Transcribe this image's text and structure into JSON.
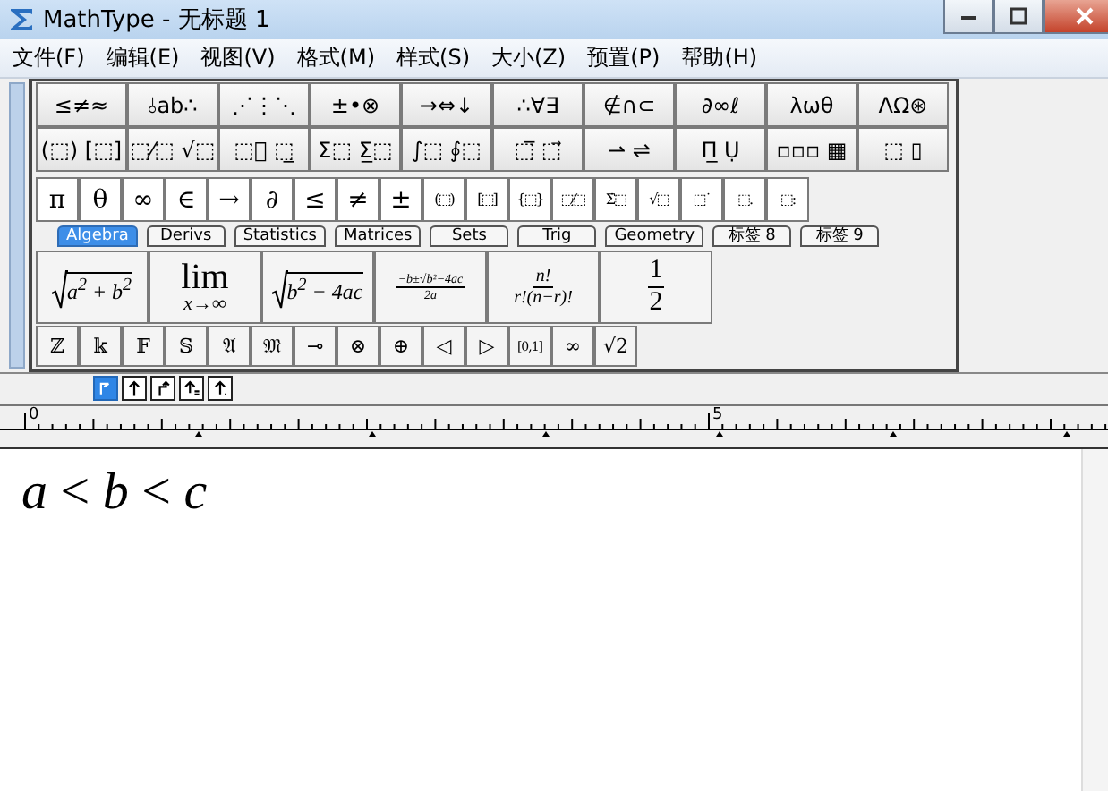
{
  "window": {
    "title": "MathType - 无标题 1"
  },
  "menu": [
    "文件(F)",
    "编辑(E)",
    "视图(V)",
    "格式(M)",
    "样式(S)",
    "大小(Z)",
    "预置(P)",
    "帮助(H)"
  ],
  "palette_row_1": [
    "≤≠≈",
    "⫰ab∴",
    "⋰⋮⋱",
    "±•⊗",
    "→⇔↓",
    "∴∀∃",
    "∉∩⊂",
    "∂∞ℓ",
    "λωθ",
    "ΛΩ⊛"
  ],
  "palette_row_2": [
    "(⬚) [⬚]",
    "⬚⁄⬚ √⬚",
    "⬚⃞ ⬚̲",
    "Σ⬚ Σ̲⬚",
    "∫⬚ ∮⬚",
    "⬚̅ ⬚⃗",
    "⇀ ⇌",
    "Π̲ Ụ",
    "▫▫▫ ▦",
    "⬚ ▯"
  ],
  "symbol_row": [
    "π",
    "θ",
    "∞",
    "∈",
    "→",
    "∂",
    "≤",
    "≠",
    "±",
    "(⬚)",
    "[⬚]",
    "{⬚}",
    "⬚⁄⬚",
    "Σ̇⬚",
    "√⬚",
    "⬚˙",
    "⬚.",
    "⬚:"
  ],
  "tabs": [
    {
      "label": "Algebra",
      "selected": true
    },
    {
      "label": "Derivs",
      "selected": false
    },
    {
      "label": "Statistics",
      "selected": false
    },
    {
      "label": "Matrices",
      "selected": false
    },
    {
      "label": "Sets",
      "selected": false
    },
    {
      "label": "Trig",
      "selected": false
    },
    {
      "label": "Geometry",
      "selected": false
    },
    {
      "label": "标签 8",
      "selected": false
    },
    {
      "label": "标签 9",
      "selected": false
    }
  ],
  "templates": [
    {
      "kind": "sqrt",
      "body": "*a*$^{2}$ + *b*$^{2}$"
    },
    {
      "kind": "limit",
      "top": "lim",
      "bottom": "x→∞"
    },
    {
      "kind": "sqrt",
      "body": "b$^{2}$ − 4ac"
    },
    {
      "kind": "fraction",
      "numerator": "−b±√b²−4ac",
      "denominator": "2a"
    },
    {
      "kind": "fraction",
      "numerator": "n!",
      "denominator": "r!(n−r)!"
    },
    {
      "kind": "fraction",
      "numerator": "1",
      "denominator": "2"
    }
  ],
  "bottom_row": [
    "ℤ",
    "𝕜",
    "𝔽",
    "𝕊",
    "𝔄",
    "𝔐",
    "⊸",
    "⊗",
    "⊕",
    "◁",
    "▷",
    "[0,1]",
    "∞",
    "√2"
  ],
  "nudge_buttons": [
    {
      "selected": true
    },
    {
      "selected": false
    },
    {
      "selected": false
    },
    {
      "selected": false
    },
    {
      "selected": false
    }
  ],
  "ruler": {
    "labels": [
      "0",
      "5"
    ]
  },
  "editor": {
    "equation": "*a* < *b* < *c*"
  }
}
